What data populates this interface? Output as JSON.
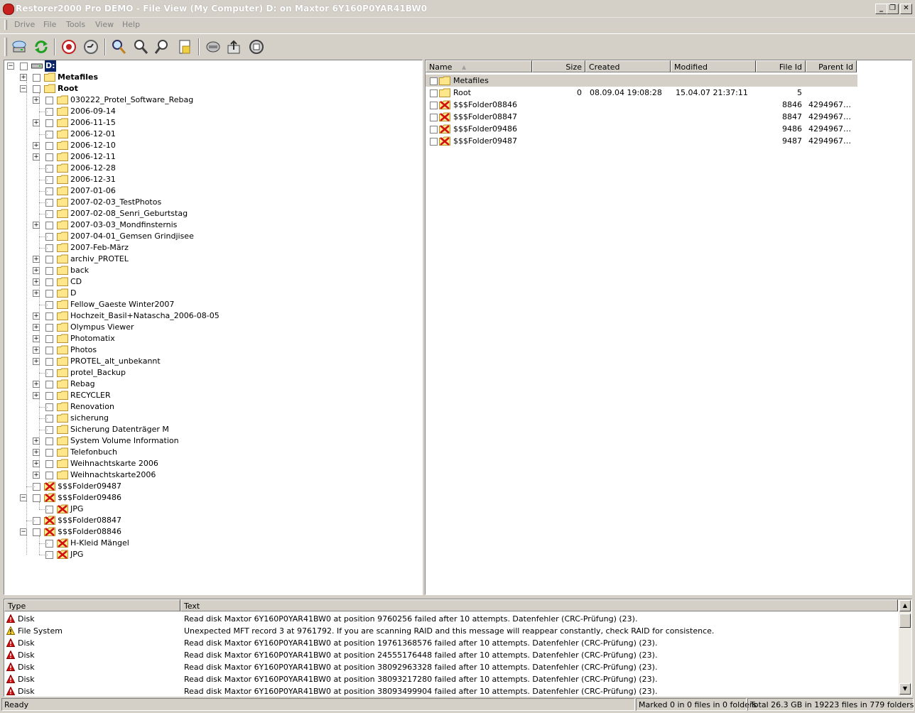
{
  "window": {
    "title": "Restorer2000 Pro DEMO - File View (My Computer) D: on Maxtor 6Y160P0YAR41BW0",
    "controls": {
      "minimize": "_",
      "restore": "❐",
      "close": "✕"
    }
  },
  "menu": [
    "Drive",
    "File",
    "Tools",
    "View",
    "Help"
  ],
  "toolbar": {
    "buttons": [
      "connect-drive-icon",
      "refresh-icon",
      "stop-icon",
      "scan-icon",
      "search-icon",
      "find-next-icon",
      "find-previous-icon",
      "mask-icon",
      "recover-drive-icon",
      "recover-icon",
      "recover-marked-icon"
    ]
  },
  "tree": {
    "drive_label": "D:",
    "metafiles": "Metafiles",
    "root": "Root",
    "root_children": [
      {
        "label": "030222_Protel_Software_Rebag",
        "expandable": true
      },
      {
        "label": "2006-09-14",
        "expandable": false
      },
      {
        "label": "2006-11-15",
        "expandable": true
      },
      {
        "label": "2006-12-01",
        "expandable": false
      },
      {
        "label": "2006-12-10",
        "expandable": true
      },
      {
        "label": "2006-12-11",
        "expandable": true
      },
      {
        "label": "2006-12-28",
        "expandable": false
      },
      {
        "label": "2006-12-31",
        "expandable": false
      },
      {
        "label": "2007-01-06",
        "expandable": false
      },
      {
        "label": "2007-02-03_TestPhotos",
        "expandable": false
      },
      {
        "label": "2007-02-08_Senri_Geburtstag",
        "expandable": false
      },
      {
        "label": "2007-03-03_Mondfinsternis",
        "expandable": true
      },
      {
        "label": "2007-04-01_Gemsen Grindjisee",
        "expandable": false
      },
      {
        "label": "2007-Feb-März",
        "expandable": false
      },
      {
        "label": "archiv_PROTEL",
        "expandable": true
      },
      {
        "label": "back",
        "expandable": true
      },
      {
        "label": "CD",
        "expandable": true
      },
      {
        "label": "D",
        "expandable": true
      },
      {
        "label": "Fellow_Gaeste Winter2007",
        "expandable": false
      },
      {
        "label": "Hochzeit_Basil+Natascha_2006-08-05",
        "expandable": true
      },
      {
        "label": "Olympus Viewer",
        "expandable": true
      },
      {
        "label": "Photomatix",
        "expandable": true
      },
      {
        "label": "Photos",
        "expandable": true
      },
      {
        "label": "PROTEL_alt_unbekannt",
        "expandable": true
      },
      {
        "label": "protel_Backup",
        "expandable": false
      },
      {
        "label": "Rebag",
        "expandable": true
      },
      {
        "label": "RECYCLER",
        "expandable": true
      },
      {
        "label": "Renovation",
        "expandable": false
      },
      {
        "label": "sicherung",
        "expandable": false
      },
      {
        "label": "Sicherung Datenträger M",
        "expandable": false
      },
      {
        "label": "System Volume Information",
        "expandable": true
      },
      {
        "label": "Telefonbuch",
        "expandable": true
      },
      {
        "label": "Weihnachtskarte 2006",
        "expandable": true
      },
      {
        "label": "Weihnachtskarte2006",
        "expandable": true
      }
    ],
    "lost_folders": [
      {
        "label": "$$$Folder09487",
        "children": []
      },
      {
        "label": "$$$Folder09486",
        "children": [
          "JPG"
        ]
      },
      {
        "label": "$$$Folder08847",
        "children": []
      },
      {
        "label": "$$$Folder08846",
        "children": [
          "H-Kleid Mängel",
          "JPG"
        ]
      }
    ]
  },
  "file_list": {
    "columns": [
      "Name",
      "Size",
      "Created",
      "Modified",
      "File Id",
      "Parent Id"
    ],
    "sort_arrow": "▲",
    "rows": [
      {
        "name": "Metafiles",
        "size": "",
        "created": "",
        "modified": "",
        "file_id": "",
        "parent_id": "",
        "deleted": false,
        "highlight": true
      },
      {
        "name": "Root",
        "size": "0",
        "created": "08.09.04 19:08:28",
        "modified": "15.04.07 21:37:11",
        "file_id": "5",
        "parent_id": "",
        "deleted": false,
        "highlight": false
      },
      {
        "name": "$$$Folder08846",
        "size": "",
        "created": "",
        "modified": "",
        "file_id": "8846",
        "parent_id": "4294967…",
        "deleted": true,
        "highlight": false
      },
      {
        "name": "$$$Folder08847",
        "size": "",
        "created": "",
        "modified": "",
        "file_id": "8847",
        "parent_id": "4294967…",
        "deleted": true,
        "highlight": false
      },
      {
        "name": "$$$Folder09486",
        "size": "",
        "created": "",
        "modified": "",
        "file_id": "9486",
        "parent_id": "4294967…",
        "deleted": true,
        "highlight": false
      },
      {
        "name": "$$$Folder09487",
        "size": "",
        "created": "",
        "modified": "",
        "file_id": "9487",
        "parent_id": "4294967…",
        "deleted": true,
        "highlight": false
      }
    ]
  },
  "log": {
    "columns": [
      "Type",
      "Text"
    ],
    "rows": [
      {
        "type": "Disk",
        "severity": "error",
        "text": "Read disk Maxtor 6Y160P0YAR41BW0 at position 9760256 failed after 10 attempts. Datenfehler (CRC-Prüfung) (23)."
      },
      {
        "type": "File System",
        "severity": "warning",
        "text": "Unexpected MFT record 3 at 9761792. If you are scanning RAID and this message will reappear constantly, check RAID for consistence."
      },
      {
        "type": "Disk",
        "severity": "error",
        "text": "Read disk Maxtor 6Y160P0YAR41BW0 at position 19761368576 failed after 10 attempts. Datenfehler (CRC-Prüfung) (23)."
      },
      {
        "type": "Disk",
        "severity": "error",
        "text": "Read disk Maxtor 6Y160P0YAR41BW0 at position 24555176448 failed after 10 attempts. Datenfehler (CRC-Prüfung) (23)."
      },
      {
        "type": "Disk",
        "severity": "error",
        "text": "Read disk Maxtor 6Y160P0YAR41BW0 at position 38092963328 failed after 10 attempts. Datenfehler (CRC-Prüfung) (23)."
      },
      {
        "type": "Disk",
        "severity": "error",
        "text": "Read disk Maxtor 6Y160P0YAR41BW0 at position 38093217280 failed after 10 attempts. Datenfehler (CRC-Prüfung) (23)."
      },
      {
        "type": "Disk",
        "severity": "error",
        "text": "Read disk Maxtor 6Y160P0YAR41BW0 at position 38093499904 failed after 10 attempts. Datenfehler (CRC-Prüfung) (23)."
      }
    ]
  },
  "status": {
    "ready": "Ready",
    "marked": "Marked 0 in 0 files in 0 folders",
    "total": "Total 26.3 GB in 19223 files in 779 folders"
  },
  "colors": {
    "selection": "#0a246a",
    "folder_fill": "#ffe68a",
    "folder_stroke": "#b8922a",
    "deleted_red": "#d01010",
    "window_face": "#d4d0c8"
  }
}
